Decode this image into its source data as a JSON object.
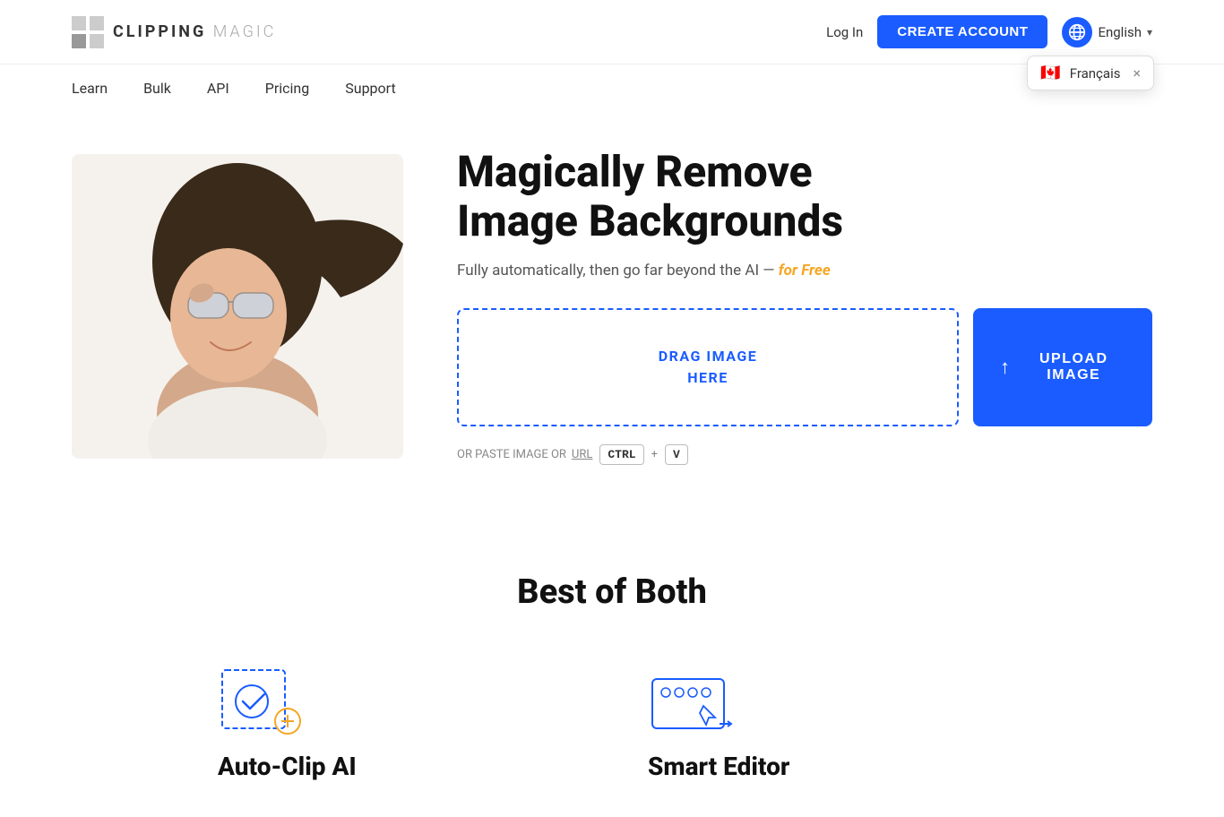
{
  "header": {
    "logo_text_bold": "CLIPPING",
    "logo_text_light": "MAGIC",
    "login_label": "Log In",
    "create_account_label": "CREATE ACCOUNT",
    "language_label": "English",
    "language_arrow": "▾"
  },
  "lang_popup": {
    "language": "Français",
    "close": "×"
  },
  "nav": {
    "items": [
      {
        "label": "Learn",
        "id": "learn"
      },
      {
        "label": "Bulk",
        "id": "bulk"
      },
      {
        "label": "API",
        "id": "api"
      },
      {
        "label": "Pricing",
        "id": "pricing"
      },
      {
        "label": "Support",
        "id": "support"
      }
    ]
  },
  "hero": {
    "title_line1": "Magically Remove",
    "title_line2": "Image Backgrounds",
    "subtitle_prefix": "Fully automatically, then go far beyond the AI —",
    "subtitle_free": "for Free",
    "drag_line1": "DRAG IMAGE",
    "drag_line2": "HERE",
    "upload_label": "UPLOAD IMAGE",
    "paste_prefix": "OR PASTE IMAGE OR",
    "url_label": "URL",
    "ctrl_label": "CTRL",
    "v_label": "V"
  },
  "features": {
    "title": "Best of Both",
    "items": [
      {
        "title": "Auto-Clip AI",
        "id": "auto-clip"
      },
      {
        "title": "Smart Editor",
        "id": "smart-editor"
      }
    ]
  },
  "colors": {
    "accent_blue": "#1a5cff",
    "free_orange": "#f5a623"
  }
}
